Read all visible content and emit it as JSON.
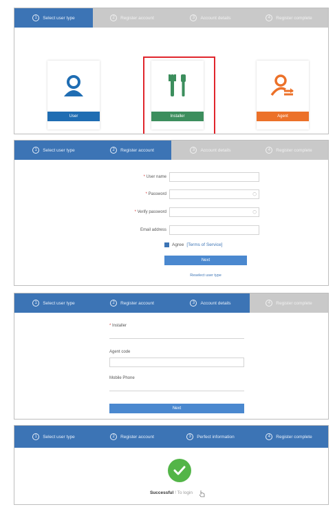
{
  "steps_1": [
    {
      "num": "1",
      "label": "Select user type"
    },
    {
      "num": "2",
      "label": "Register account"
    },
    {
      "num": "3",
      "label": "Account details"
    },
    {
      "num": "4",
      "label": "Register complete"
    }
  ],
  "steps_4": [
    {
      "num": "1",
      "label": "Select user type"
    },
    {
      "num": "2",
      "label": "Register account"
    },
    {
      "num": "3",
      "label": "Perfect information"
    },
    {
      "num": "4",
      "label": "Register complete"
    }
  ],
  "user_types": {
    "user": {
      "label": "User",
      "color": "#1f6db3",
      "icon": "user-icon"
    },
    "installer": {
      "label": "Installer",
      "color": "#3c8e5d",
      "icon": "tools-icon",
      "selected": true
    },
    "agent": {
      "label": "Agent",
      "color": "#ec7129",
      "icon": "agent-icon"
    }
  },
  "register_form": {
    "username_label": "User name",
    "password_label": "Password",
    "verify_label": "Verify password",
    "email_label": "Email address",
    "agree_label": "Agree",
    "terms_label": "[Terms of Service]",
    "next_label": "Next",
    "reselect_label": "Reselect user type",
    "agree_checked": true
  },
  "account_details": {
    "installer_label": "Installer",
    "agent_code_label": "Agent code",
    "mobile_label": "Mobile Phone",
    "next_label": "Next"
  },
  "complete": {
    "success_label": "Successful",
    "sub_label": "To login"
  }
}
